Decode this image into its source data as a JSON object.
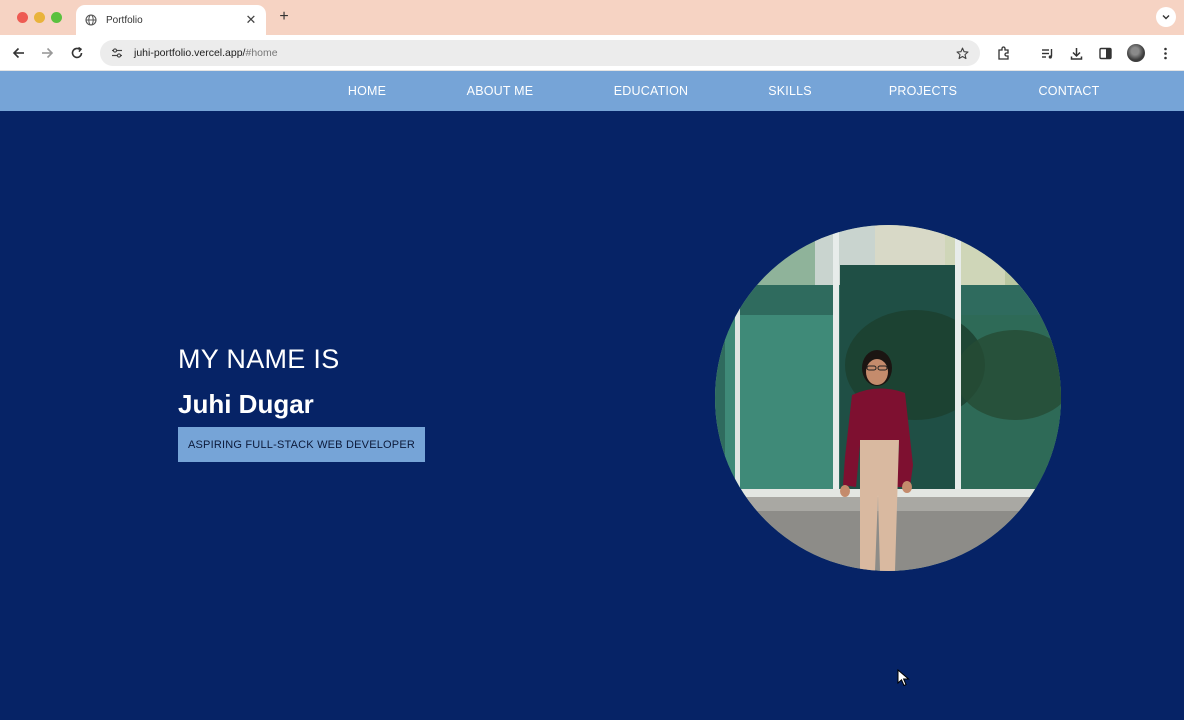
{
  "browser": {
    "tab_title": "Portfolio",
    "url_host": "juhi-portfolio.vercel.app/",
    "url_path": "#home"
  },
  "nav": {
    "items": [
      {
        "label": "HOME"
      },
      {
        "label": "ABOUT ME"
      },
      {
        "label": "EDUCATION"
      },
      {
        "label": "SKILLS"
      },
      {
        "label": "PROJECTS"
      },
      {
        "label": "CONTACT"
      }
    ]
  },
  "hero": {
    "intro": "MY NAME IS",
    "name": "Juhi Dugar",
    "role": "ASPIRING FULL-STACK WEB DEVELOPER"
  },
  "icons": {
    "tab_favicon": "globe-icon",
    "tab_close": "close-icon",
    "new_tab": "plus-icon",
    "back": "back-arrow-icon",
    "forward": "forward-arrow-icon",
    "reload": "reload-icon",
    "site_info": "tune-icon",
    "bookmark": "star-icon",
    "extensions": "puzzle-icon",
    "media": "media-control-icon",
    "downloads": "download-icon",
    "side_panel": "side-panel-icon",
    "menu": "kebab-menu-icon"
  },
  "colors": {
    "page_bg": "#062366",
    "nav_bg": "#76a4d7",
    "tabstrip_bg": "#f6d3c3"
  }
}
